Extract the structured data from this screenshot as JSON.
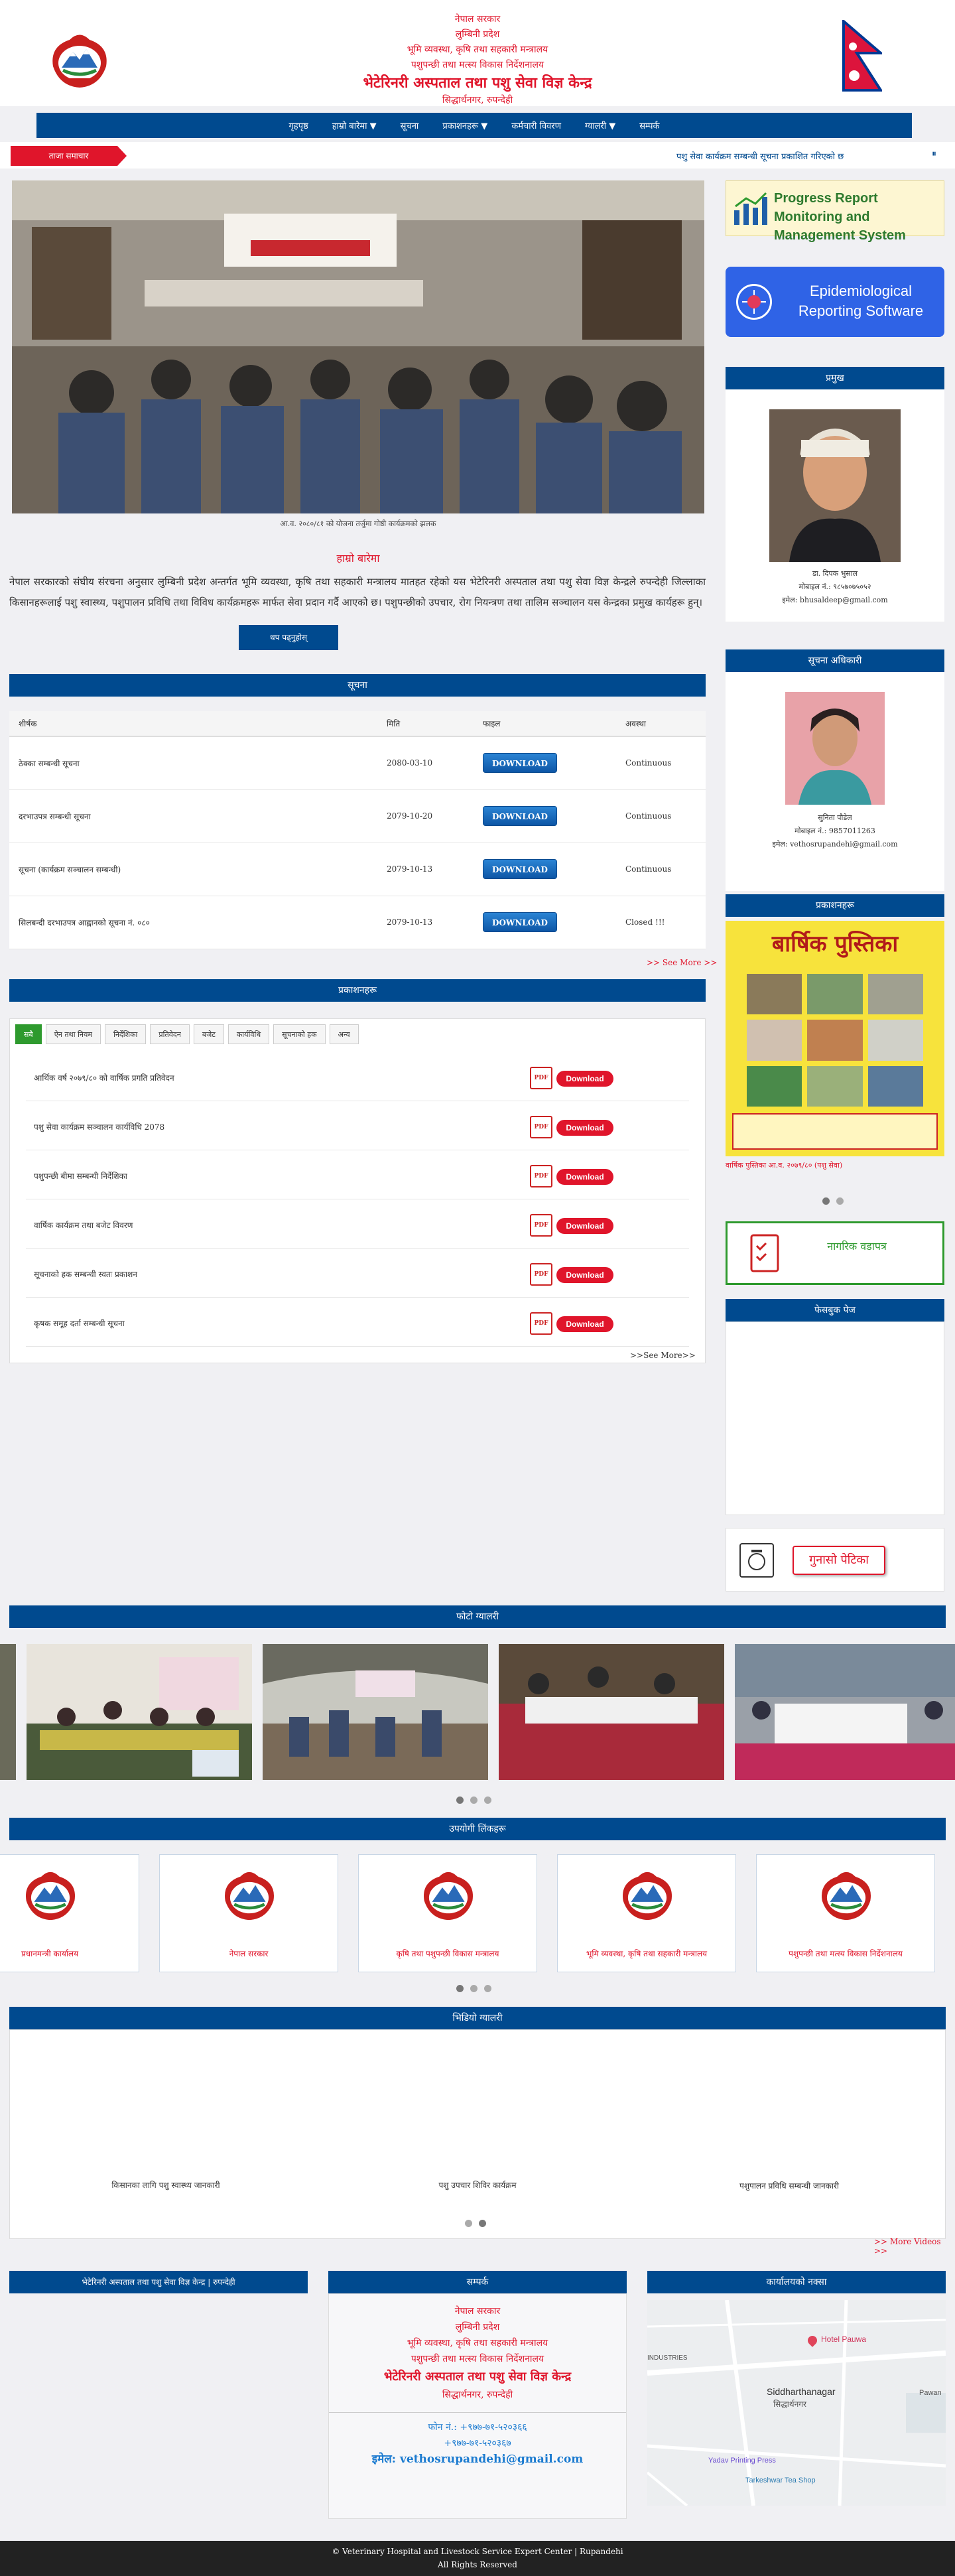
{
  "header": {
    "line1": "नेपाल सरकार",
    "line2": "लुम्बिनी प्रदेश",
    "line3": "भूमि व्यवस्था, कृषि तथा सहकारी मन्त्रालय",
    "line4": "पशुपन्छी तथा मत्स्य विकास निर्देशनालय",
    "line5": "भेटेरिनरी अस्पताल तथा पशु सेवा विज्ञ केन्द्र",
    "line6": "सिद्धार्थनगर, रुपन्देही"
  },
  "nav": {
    "items": [
      {
        "label": "गृहपृष्ठ",
        "dropdown": false
      },
      {
        "label": "हाम्रो बारेमा",
        "dropdown": true
      },
      {
        "label": "सूचना",
        "dropdown": false
      },
      {
        "label": "प्रकाशनहरू",
        "dropdown": true
      },
      {
        "label": "कर्मचारी विवरण",
        "dropdown": false
      },
      {
        "label": "ग्यालरी",
        "dropdown": true
      },
      {
        "label": "सम्पर्क",
        "dropdown": false
      }
    ]
  },
  "ticker": {
    "badge": "ताजा समाचार",
    "text": "पशु सेवा कार्यक्रम सम्बन्धी सूचना प्रकाशित गरिएको छ"
  },
  "hero": {
    "caption": "आ.व. २०८०/८१ को योजना तर्जुमा गोष्ठी कार्यक्रमको झलक"
  },
  "intro": {
    "title": "हाम्रो बारेमा",
    "body": "नेपाल सरकारको संघीय संरचना अनुसार लुम्बिनी प्रदेश अन्तर्गत भूमि व्यवस्था, कृषि तथा सहकारी मन्त्रालय मातहत रहेको यस भेटेरिनरी अस्पताल तथा पशु सेवा विज्ञ केन्द्रले रुपन्देही जिल्लाका किसानहरूलाई पशु स्वास्थ्य, पशुपालन प्रविधि तथा विविध कार्यक्रमहरू मार्फत सेवा प्रदान गर्दै आएको छ। पशुपन्छीको उपचार, रोग नियन्त्रण तथा तालिम सञ्चालन यस केन्द्रका प्रमुख कार्यहरू हुन्।",
    "read_more": "थप पढ्नुहोस्"
  },
  "notices": {
    "title": "सूचना",
    "columns": [
      "शीर्षक",
      "मिति",
      "फाइल",
      "अवस्था"
    ],
    "rows": [
      {
        "title": "ठेक्का सम्बन्धी सूचना",
        "date": "2080-03-10",
        "file": "DOWNLOAD",
        "status": "Continuous"
      },
      {
        "title": "दरभाउपत्र सम्बन्धी सूचना",
        "date": "2079-10-20",
        "file": "DOWNLOAD",
        "status": "Continuous"
      },
      {
        "title": "सूचना (कार्यक्रम सञ्चालन सम्बन्धी)",
        "date": "2079-10-13",
        "file": "DOWNLOAD",
        "status": "Continuous"
      },
      {
        "title": "सिलबन्दी दरभाउपत्र आह्वानको सूचना नं. ०८०",
        "date": "2079-10-13",
        "file": "DOWNLOAD",
        "status": "Closed !!!"
      }
    ],
    "see_more": ">> See More >>"
  },
  "publications": {
    "title": "प्रकाशनहरू",
    "tabs": [
      "सबै",
      "ऐन तथा नियम",
      "निर्देशिका",
      "प्रतिवेदन",
      "बजेट",
      "कार्यविधि",
      "सूचनाको हक",
      "अन्य"
    ],
    "rows": [
      {
        "title": "आर्थिक वर्ष २०७९/८० को वार्षिक प्रगति प्रतिवेदन"
      },
      {
        "title": "पशु सेवा कार्यक्रम सञ्चालन कार्यविधि 2078"
      },
      {
        "title": "पशुपन्छी बीमा सम्बन्धी निर्देशिका"
      },
      {
        "title": "वार्षिक कार्यक्रम तथा बजेट विवरण"
      },
      {
        "title": "सूचनाको हक सम्बन्धी स्वतः प्रकाशन"
      },
      {
        "title": "कृषक समूह दर्ता सम्बन्धी सूचना"
      }
    ],
    "download_label": "Download",
    "see_more": ">>See More>>"
  },
  "sidebar": {
    "banner1": "Progress Report Monitoring and Management System",
    "banner2": "Epidemiological Reporting Software",
    "chief": {
      "title": "प्रमुख",
      "name": "डा. दिपक भुसाल",
      "phone": "मोबाइल नं.: ९८५७०७५०५२",
      "email": "इमेल: bhusaldeep@gmail.com"
    },
    "info_officer": {
      "title": "सूचना अधिकारी",
      "name": "सुनिता पौडेल",
      "phone": "मोबाइल नं.: 9857011263",
      "email": "इमेल: vethosrupandehi@gmail.com"
    },
    "publication": {
      "title": "प्रकाशनहरू",
      "cover_title": "बार्षिक पुस्तिका",
      "caption": "वार्षिक पुस्तिका आ.व. २०७९/८० (पशु सेवा)"
    },
    "citizen_charter": "नागरिक वडापत्र",
    "facebook_title": "फेसबुक पेज",
    "complaint": "गुनासो पेटिका"
  },
  "gallery": {
    "title": "फोटो ग्यालरी"
  },
  "links": {
    "title": "उपयोगी लिंकहरू",
    "items": [
      {
        "label": "प्रधानमन्त्री कार्यालय"
      },
      {
        "label": "नेपाल सरकार"
      },
      {
        "label": "कृषि तथा पशुपन्छी विकास मन्त्रालय"
      },
      {
        "label": "भूमि व्यवस्था, कृषि तथा सहकारी मन्त्रालय"
      },
      {
        "label": "पशुपन्छी तथा मत्स्य विकास निर्देशनालय"
      }
    ]
  },
  "videos": {
    "title": "भिडियो ग्यालरी",
    "items": [
      {
        "title": "किसानका लागि पशु स्वास्थ्य जानकारी"
      },
      {
        "title": "पशु उपचार शिविर कार्यक्रम"
      },
      {
        "title": "पशुपालन प्रविधि सम्बन्धी जानकारी"
      }
    ],
    "more": ">> More Videos >>"
  },
  "footer": {
    "col1_title": "भेटेरिनरी अस्पताल तथा पशु सेवा विज्ञ केन्द्र | रुपन्देही",
    "col2_title": "सम्पर्क",
    "col3_title": "कार्यालयको नक्सा",
    "address": {
      "line1": "नेपाल सरकार",
      "line2": "लुम्बिनी प्रदेश",
      "line3": "भूमि व्यवस्था, कृषि तथा सहकारी मन्त्रालय",
      "line4": "पशुपन्छी तथा मत्स्य विकास निर्देशनालय",
      "line5": "भेटेरिनरी अस्पताल तथा पशु सेवा विज्ञ केन्द्र",
      "line6": "सिद्धार्थनगर, रुपन्देही"
    },
    "phone1": "फोन नं.: +९७७-७१-५२०३६६",
    "phone2": "+९७७-७१-५२०३६७",
    "email": "इमेल: vethosrupandehi@gmail.com",
    "map": {
      "place": "Siddharthanagar",
      "place_local": "सिद्धार्थनगर",
      "hotel": "Hotel Pauwa",
      "industries": "INDUSTRIES",
      "printing": "Yadav Printing Press",
      "tea": "Tarkeshwar Tea Shop",
      "pawan": "Pawan"
    },
    "copyright": "© Veterinary Hospital and Livestock Service Expert Center | Rupandehi",
    "rights": "All Rights Reserved"
  },
  "colors": {
    "primary": "#004a8f",
    "accent": "#e0152b",
    "green": "#2e9a2e"
  }
}
